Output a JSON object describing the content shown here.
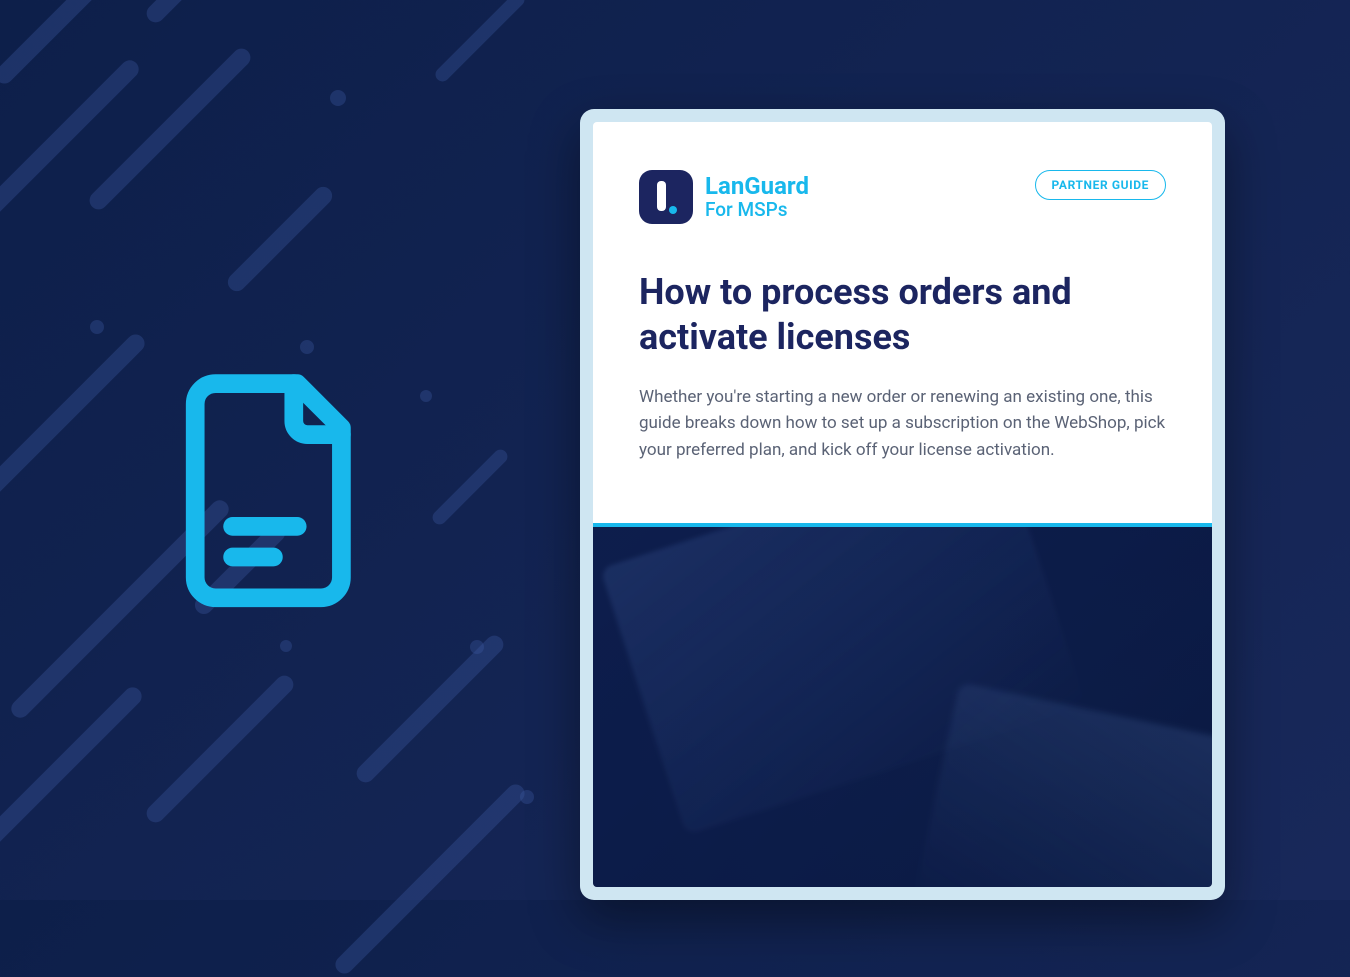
{
  "brand": {
    "name_line1": "LanGuard",
    "name_line2": "For MSPs"
  },
  "badge": "PARTNER GUIDE",
  "title": "How to process orders and activate licenses",
  "intro": "Whether you're starting a new order or renewing an existing one, this guide breaks down how to set up a subscription on the WebShop, pick your preferred plan, and kick off your license activation.",
  "colors": {
    "accent": "#18b8ec",
    "brand_dark": "#1c2560",
    "bg_start": "#0d1f4a",
    "bg_end": "#18285a"
  }
}
